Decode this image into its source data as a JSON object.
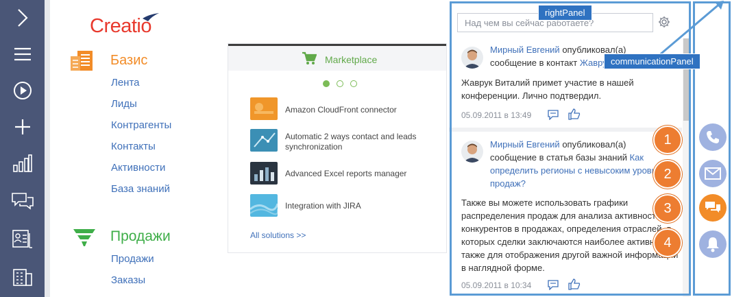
{
  "nav": {
    "items": [
      {
        "icon": "chevron-right-icon"
      },
      {
        "icon": "menu-icon"
      },
      {
        "icon": "play-icon"
      },
      {
        "icon": "plus-icon"
      },
      {
        "icon": "bar-chart-icon"
      },
      {
        "icon": "chat-icon"
      },
      {
        "icon": "contact-card-icon"
      },
      {
        "icon": "building-icon"
      }
    ],
    "background": "#4a5677"
  },
  "main": {
    "logo": "Creatio",
    "sections": [
      {
        "title": "Базис",
        "color": "#f28c28",
        "icon": "basis-icon",
        "links": [
          "Лента",
          "Лиды",
          "Контрагенты",
          "Контакты",
          "Активности",
          "База знаний"
        ]
      },
      {
        "title": "Продажи",
        "color": "#3fae49",
        "icon": "sales-funnel-icon",
        "links": [
          "Продажи",
          "Заказы"
        ]
      }
    ],
    "marketplace": {
      "title": "Marketplace",
      "solutions": [
        {
          "name": "Amazon CloudFront connector",
          "thumb": "amazon-cloudfront-thumb"
        },
        {
          "name": "Automatic 2 ways contact and leads synchronization",
          "thumb": "sync-thumb"
        },
        {
          "name": "Advanced Excel reports manager",
          "thumb": "excel-reports-thumb"
        },
        {
          "name": "Integration with JIRA",
          "thumb": "jira-thumb"
        }
      ],
      "all_solutions": "All solutions >>",
      "carousel_active": 1,
      "carousel_total": 3
    }
  },
  "right_panel": {
    "search_placeholder": "Над чем вы сейчас работаете?",
    "posts": [
      {
        "author": "Мирный Евгений",
        "verb": "опубликовал(а) сообщение в контакт",
        "target": "Жаврук Виталий",
        "body": "Жаврук Виталий примет участие в нашей конференции. Лично подтвердил.",
        "date": "05.09.2011 в 13:49"
      },
      {
        "author": "Мирный Евгений",
        "verb": "опубликовал(а) сообщение в статья базы знаний",
        "target": "Как определить регионы с невысоким уровнем продаж?",
        "body": "Также вы можете использовать графики распределения продаж для анализа активности конкурентов в продажах, определения отраслей, в которых сделки заключаются наиболее активно, а также для отображения другой важной информации в наглядной форме.",
        "date": "05.09.2011 в 10:34"
      }
    ]
  },
  "comm_panel": {
    "buttons": [
      {
        "icon": "phone-icon",
        "color": "#9fb2e0",
        "active": false
      },
      {
        "icon": "email-icon",
        "color": "#9fb2e0",
        "active": false
      },
      {
        "icon": "chat-icon",
        "color": "#f28c28",
        "active": true
      },
      {
        "icon": "bell-icon",
        "color": "#9fb2e0",
        "active": false
      }
    ]
  },
  "annotations": {
    "right_panel_label": "rightPanel",
    "comm_panel_label": "communicationPanel",
    "numbers": [
      "1",
      "2",
      "3",
      "4"
    ],
    "color": "#ed7d31",
    "frame_color": "#5b9bd5"
  }
}
